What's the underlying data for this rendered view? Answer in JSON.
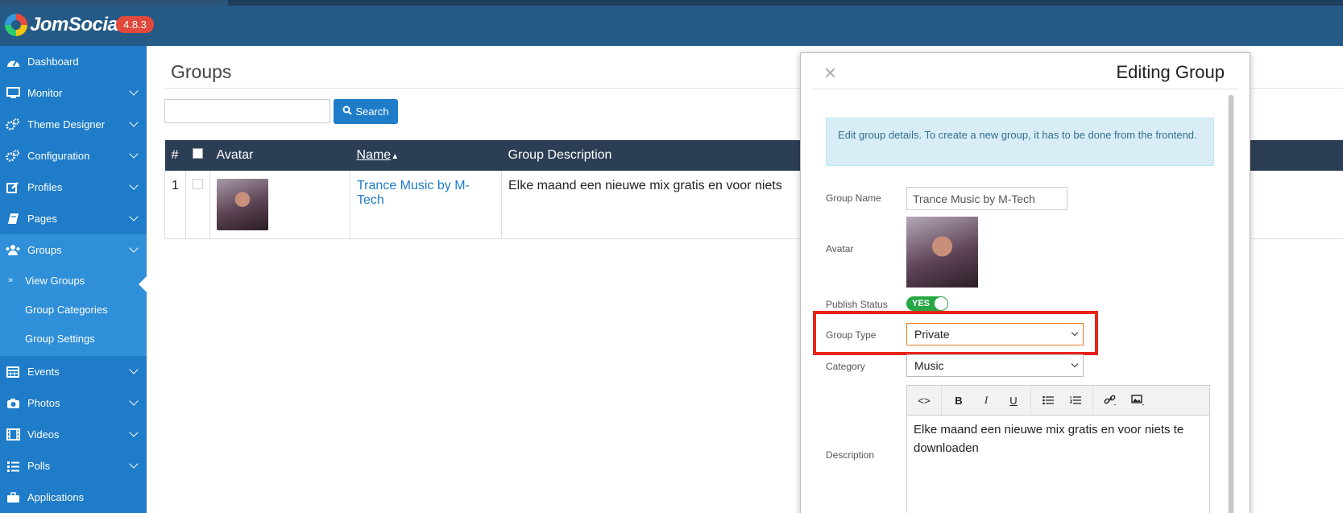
{
  "app": {
    "name": "JomSocial",
    "version": "4.8.3"
  },
  "sidebar": {
    "items": [
      {
        "label": "Dashboard",
        "icon": "dashboard-icon",
        "has_children": false
      },
      {
        "label": "Monitor",
        "icon": "monitor-icon",
        "has_children": true
      },
      {
        "label": "Theme Designer",
        "icon": "cogs-icon",
        "has_children": true
      },
      {
        "label": "Configuration",
        "icon": "cogs-icon",
        "has_children": true
      },
      {
        "label": "Profiles",
        "icon": "edit-icon",
        "has_children": true
      },
      {
        "label": "Pages",
        "icon": "book-icon",
        "has_children": true
      },
      {
        "label": "Groups",
        "icon": "users-icon",
        "has_children": true,
        "active": true
      },
      {
        "label": "Events",
        "icon": "calendar-icon",
        "has_children": true
      },
      {
        "label": "Photos",
        "icon": "camera-icon",
        "has_children": true
      },
      {
        "label": "Videos",
        "icon": "film-icon",
        "has_children": true
      },
      {
        "label": "Polls",
        "icon": "list-icon",
        "has_children": true
      },
      {
        "label": "Applications",
        "icon": "briefcase-icon",
        "has_children": false
      }
    ],
    "groups_sub": [
      {
        "label": "View Groups",
        "current": true
      },
      {
        "label": "Group Categories"
      },
      {
        "label": "Group Settings"
      }
    ]
  },
  "main": {
    "title": "Groups",
    "search": {
      "value": "",
      "button_label": "Search"
    },
    "table": {
      "columns": [
        "#",
        "",
        "Avatar",
        "Name",
        "Group Description"
      ],
      "sort_indicator": "▲",
      "rows": [
        {
          "num": "1",
          "name": "Trance Music by M-Tech",
          "description": "Elke maand een nieuwe mix gratis en voor niets"
        }
      ]
    }
  },
  "modal": {
    "title": "Editing Group",
    "close_glyph": "×",
    "info": "Edit group details. To create a new group, it has to be done from the frontend.",
    "labels": {
      "group_name": "Group Name",
      "avatar": "Avatar",
      "publish_status": "Publish Status",
      "group_type": "Group Type",
      "category": "Category",
      "description": "Description"
    },
    "group_name_value": "Trance Music by M-Tech",
    "publish_status_value": "YES",
    "group_type_value": "Private",
    "category_value": "Music",
    "editor": {
      "toolbar": [
        "<>",
        "B",
        "I",
        "U"
      ],
      "content": "Elke maand een nieuwe mix gratis en voor niets te downloaden"
    }
  },
  "colors": {
    "header": "#255a86",
    "sidebar": "#1e7cc8",
    "sidebar_active": "#2f8fd8",
    "table_header": "#2c3e55",
    "version_badge": "#e0493b",
    "highlight": "#e8231a",
    "toggle_on": "#28a745"
  }
}
